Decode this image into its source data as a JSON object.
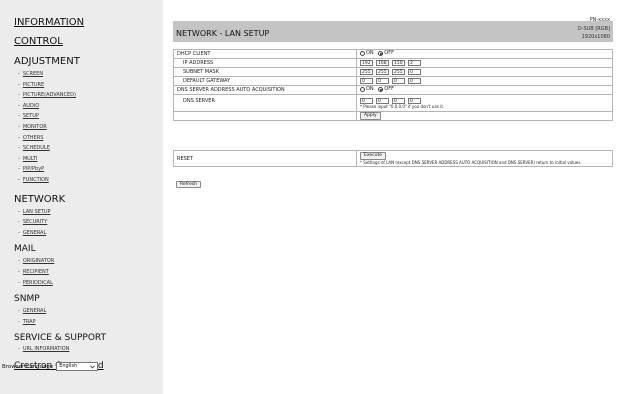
{
  "sidebar": {
    "information": "INFORMATION",
    "control": "CONTROL",
    "adjustment": {
      "title": "ADJUSTMENT",
      "items": [
        "SCREEN",
        "PICTURE",
        "PICTURE(ADVANCED)",
        "AUDIO",
        "SETUP",
        "MONITOR",
        "OTHERS",
        "SCHEDULE",
        "MULTI",
        "PIP/PbyP",
        "FUNCTION"
      ]
    },
    "network": {
      "title": "NETWORK",
      "items": [
        "LAN SETUP",
        "SECURITY",
        "GENERAL"
      ]
    },
    "mail": {
      "title": "MAIL",
      "items": [
        "ORIGINATOR",
        "RECIPIENT",
        "PERIODICAL"
      ]
    },
    "snmp": {
      "title": "SNMP",
      "items": [
        "GENERAL",
        "TRAP"
      ]
    },
    "service": {
      "title": "SERVICE & SUPPORT",
      "items": [
        "URL INFORMATION"
      ]
    },
    "crestron": "Crestron Connected",
    "browser_language_label": "Browser Language",
    "browser_language_value": "English"
  },
  "header": {
    "title": "NETWORK - LAN SETUP",
    "model": "PN-xxxx",
    "input": "D-SUB [RGB]",
    "resolution": "1920x1080"
  },
  "lan": {
    "dhcp_label": "DHCP CLIENT",
    "on_label": "ON",
    "off_label": "OFF",
    "ip_label": "IP ADDRESS",
    "ip": [
      "192",
      "168",
      "150",
      "2"
    ],
    "mask_label": "SUBNET MASK",
    "mask": [
      "255",
      "255",
      "255",
      "0"
    ],
    "gateway_label": "DEFAULT GATEWAY",
    "gateway": [
      "0",
      "0",
      "0",
      "0"
    ],
    "dns_auto_label": "DNS SERVER ADDRESS AUTO ACQUISITION",
    "dns_label": "DNS SERVER",
    "dns": [
      "0",
      "0",
      "0",
      "0"
    ],
    "dns_note": "* Please input \"0.0.0.0\" if you don't use it.",
    "apply": "Apply"
  },
  "reset": {
    "label": "RESET",
    "button": "Execute",
    "note": "* Settings of LAN (except DNS SERVER ADDRESS AUTO ACQUISITION and DNS SERVER) return to initial values."
  },
  "refresh": "Refresh"
}
